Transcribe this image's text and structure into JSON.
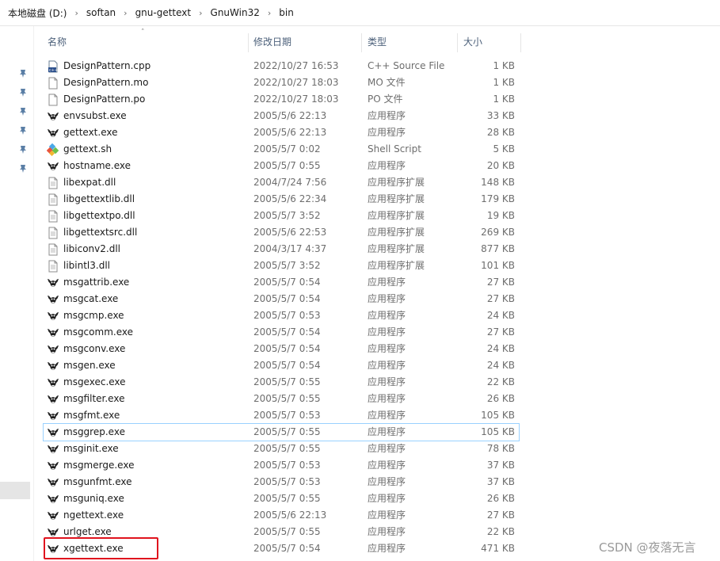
{
  "breadcrumb": [
    "本地磁盘 (D:)",
    "softan",
    "gnu-gettext",
    "GnuWin32",
    "bin"
  ],
  "columns": {
    "name": "名称",
    "modified": "修改日期",
    "type": "类型",
    "size": "大小"
  },
  "files": [
    {
      "name": "DesignPattern.cpp",
      "date": "2022/10/27 16:53",
      "type": "C++ Source File",
      "size": "1 KB",
      "icon": "cpp-file-icon"
    },
    {
      "name": "DesignPattern.mo",
      "date": "2022/10/27 18:03",
      "type": "MO 文件",
      "size": "1 KB",
      "icon": "blank-file-icon"
    },
    {
      "name": "DesignPattern.po",
      "date": "2022/10/27 18:03",
      "type": "PO 文件",
      "size": "1 KB",
      "icon": "blank-file-icon"
    },
    {
      "name": "envsubst.exe",
      "date": "2005/5/6 22:13",
      "type": "应用程序",
      "size": "33 KB",
      "icon": "gnu-exe-icon"
    },
    {
      "name": "gettext.exe",
      "date": "2005/5/6 22:13",
      "type": "应用程序",
      "size": "28 KB",
      "icon": "gnu-exe-icon"
    },
    {
      "name": "gettext.sh",
      "date": "2005/5/7 0:02",
      "type": "Shell Script",
      "size": "5 KB",
      "icon": "shell-script-icon"
    },
    {
      "name": "hostname.exe",
      "date": "2005/5/7 0:55",
      "type": "应用程序",
      "size": "20 KB",
      "icon": "gnu-exe-icon"
    },
    {
      "name": "libexpat.dll",
      "date": "2004/7/24 7:56",
      "type": "应用程序扩展",
      "size": "148 KB",
      "icon": "dll-file-icon"
    },
    {
      "name": "libgettextlib.dll",
      "date": "2005/5/6 22:34",
      "type": "应用程序扩展",
      "size": "179 KB",
      "icon": "dll-file-icon"
    },
    {
      "name": "libgettextpo.dll",
      "date": "2005/5/7 3:52",
      "type": "应用程序扩展",
      "size": "19 KB",
      "icon": "dll-file-icon"
    },
    {
      "name": "libgettextsrc.dll",
      "date": "2005/5/6 22:53",
      "type": "应用程序扩展",
      "size": "269 KB",
      "icon": "dll-file-icon"
    },
    {
      "name": "libiconv2.dll",
      "date": "2004/3/17 4:37",
      "type": "应用程序扩展",
      "size": "877 KB",
      "icon": "dll-file-icon"
    },
    {
      "name": "libintl3.dll",
      "date": "2005/5/7 3:52",
      "type": "应用程序扩展",
      "size": "101 KB",
      "icon": "dll-file-icon"
    },
    {
      "name": "msgattrib.exe",
      "date": "2005/5/7 0:54",
      "type": "应用程序",
      "size": "27 KB",
      "icon": "gnu-exe-icon"
    },
    {
      "name": "msgcat.exe",
      "date": "2005/5/7 0:54",
      "type": "应用程序",
      "size": "27 KB",
      "icon": "gnu-exe-icon"
    },
    {
      "name": "msgcmp.exe",
      "date": "2005/5/7 0:53",
      "type": "应用程序",
      "size": "24 KB",
      "icon": "gnu-exe-icon"
    },
    {
      "name": "msgcomm.exe",
      "date": "2005/5/7 0:54",
      "type": "应用程序",
      "size": "27 KB",
      "icon": "gnu-exe-icon"
    },
    {
      "name": "msgconv.exe",
      "date": "2005/5/7 0:54",
      "type": "应用程序",
      "size": "24 KB",
      "icon": "gnu-exe-icon"
    },
    {
      "name": "msgen.exe",
      "date": "2005/5/7 0:54",
      "type": "应用程序",
      "size": "24 KB",
      "icon": "gnu-exe-icon"
    },
    {
      "name": "msgexec.exe",
      "date": "2005/5/7 0:55",
      "type": "应用程序",
      "size": "22 KB",
      "icon": "gnu-exe-icon"
    },
    {
      "name": "msgfilter.exe",
      "date": "2005/5/7 0:55",
      "type": "应用程序",
      "size": "26 KB",
      "icon": "gnu-exe-icon"
    },
    {
      "name": "msgfmt.exe",
      "date": "2005/5/7 0:53",
      "type": "应用程序",
      "size": "105 KB",
      "icon": "gnu-exe-icon"
    },
    {
      "name": "msggrep.exe",
      "date": "2005/5/7 0:55",
      "type": "应用程序",
      "size": "105 KB",
      "icon": "gnu-exe-icon",
      "hover": true
    },
    {
      "name": "msginit.exe",
      "date": "2005/5/7 0:55",
      "type": "应用程序",
      "size": "78 KB",
      "icon": "gnu-exe-icon"
    },
    {
      "name": "msgmerge.exe",
      "date": "2005/5/7 0:53",
      "type": "应用程序",
      "size": "37 KB",
      "icon": "gnu-exe-icon"
    },
    {
      "name": "msgunfmt.exe",
      "date": "2005/5/7 0:53",
      "type": "应用程序",
      "size": "37 KB",
      "icon": "gnu-exe-icon"
    },
    {
      "name": "msguniq.exe",
      "date": "2005/5/7 0:55",
      "type": "应用程序",
      "size": "26 KB",
      "icon": "gnu-exe-icon"
    },
    {
      "name": "ngettext.exe",
      "date": "2005/5/6 22:13",
      "type": "应用程序",
      "size": "27 KB",
      "icon": "gnu-exe-icon"
    },
    {
      "name": "urlget.exe",
      "date": "2005/5/7 0:55",
      "type": "应用程序",
      "size": "22 KB",
      "icon": "gnu-exe-icon"
    },
    {
      "name": "xgettext.exe",
      "date": "2005/5/7 0:54",
      "type": "应用程序",
      "size": "471 KB",
      "icon": "gnu-exe-icon",
      "annotated": true
    }
  ],
  "watermark": "CSDN @夜落无言",
  "colors": {
    "header_text": "#4c607a",
    "detail_text": "#6d6d6d",
    "annotation": "#e0141e",
    "hover_border": "#99d1ff"
  }
}
